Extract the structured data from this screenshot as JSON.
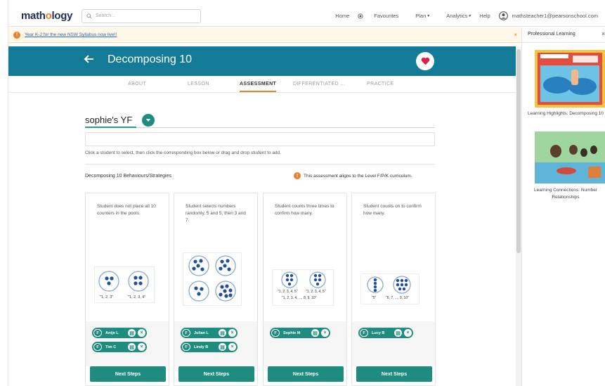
{
  "topnav": {
    "logo_part1": "math",
    "logo_o": "o",
    "logo_part2": "logy",
    "search_placeholder": "Search...",
    "links": [
      "Home",
      "Favourites",
      "Plan",
      "Analytics",
      "Help"
    ],
    "user_email": "mathsteacher1@pearsonschool.com"
  },
  "announcement": {
    "text": "Year K-2 for the new NSW Syllabus now live!!"
  },
  "hero": {
    "title": "Decomposing 10"
  },
  "tabs": [
    "ABOUT",
    "LESSON",
    "ASSESSMENT",
    "DIFFERENTIATED ...",
    "PRACTICE"
  ],
  "active_tab": "ASSESSMENT",
  "assessment": {
    "class_name": "sophie's YF",
    "instructions": "Click a student to select, then click the corresponding box below or drag and drop student to add.",
    "section_title": "Decomposing 10 Behaviours/Strategies",
    "alignment_note": "This assessment aligns to the Level F/P/K curriculum.",
    "cards": [
      {
        "description": "Student does not place all 10 counters in the pools.",
        "captions": [
          "\"1, 2, 3\"",
          "\"1, 2, 3, 4\""
        ],
        "students": [
          {
            "level": "F",
            "name": "Antje L"
          },
          {
            "level": "F",
            "name": "Tim C"
          }
        ],
        "button": "Next Steps"
      },
      {
        "description": "Student selects numbers randomly, 5 and 5, then 3 and 7.",
        "captions": [],
        "students": [
          {
            "level": "F",
            "name": "Julian L"
          },
          {
            "level": "F",
            "name": "Lindy B"
          }
        ],
        "button": "Next Steps"
      },
      {
        "description": "Student counts three times to confirm how many.",
        "captions": [
          "\"1, 2, 3, 4, 5\"",
          "\"1, 2, 3, 4, 5\"",
          "\"1, 2, 3, 4, ..., 8, 9, 10\""
        ],
        "students": [
          {
            "level": "F",
            "name": "Sophie M"
          }
        ],
        "button": "Next Steps"
      },
      {
        "description": "Student counts on to confirm how many.",
        "captions": [
          "\"5\"",
          "\"6, 7, ..., 9, 10\""
        ],
        "students": [
          {
            "level": "F",
            "name": "Lucy B"
          }
        ],
        "button": "Next Steps"
      }
    ]
  },
  "sidebar": {
    "title": "Professional Learning",
    "items": [
      {
        "caption": "Learning Highlights: Decomposing 10"
      },
      {
        "caption": "Learning Connections: Number Relationships"
      }
    ]
  },
  "colors": {
    "teal_header": "#137a97",
    "teal_button": "#1e8c7e",
    "accent_orange": "#e9802a",
    "dot_blue": "#1f4f9e"
  }
}
